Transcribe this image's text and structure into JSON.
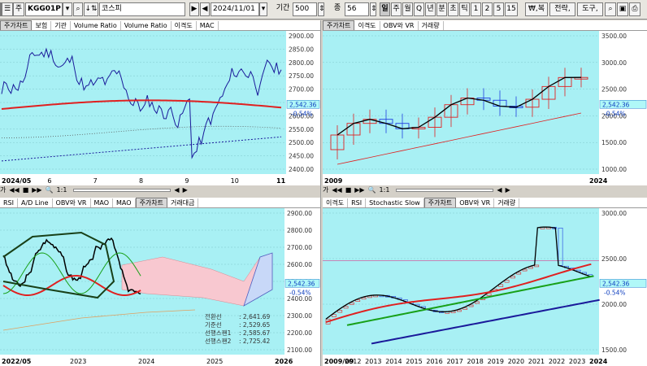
{
  "toolbar": {
    "menu_icon": "☰",
    "mode_label": "주",
    "symbol_code": "KGG01P",
    "symbol_name": "코스피",
    "date": "2024/11/01",
    "period_label": "기간",
    "period_value": "500",
    "count_label": "종",
    "count_value": "56",
    "intervals": [
      "일",
      "주",
      "월",
      "Q",
      "년",
      "분",
      "초",
      "틱",
      "1",
      "2",
      "5",
      "15"
    ],
    "active_interval": "일",
    "btn_won": "₩,복",
    "btn_strategy": "전략,",
    "btn_tools": "도구,"
  },
  "colors": {
    "panel_bg": "#a8f0f4",
    "up_candle": "#e02020",
    "down_candle": "#2040e0",
    "ma_red": "#e02020",
    "ma_green": "#18a018",
    "ma_navy": "#1a1a9a",
    "price_tag": "#b0f8f8"
  },
  "panels": {
    "tl": {
      "tabs": [
        "주가차트",
        "보험",
        "기관",
        "Volume Ratio",
        "Volume Ratio",
        "이격도",
        "MAC"
      ],
      "active_tab": "주가차트",
      "price_tag": "2,542.36",
      "change_pct": "-0.54%",
      "y_ticks": [
        "2900.00",
        "2850.00",
        "2800.00",
        "2750.00",
        "2700.00",
        "2650.00",
        "2600.00",
        "2550.00",
        "2500.00",
        "2450.00",
        "2400.00"
      ],
      "x_labels": [
        "2024/05",
        "6",
        "7",
        "8",
        "9",
        "10",
        "11"
      ]
    },
    "tr": {
      "tabs": [
        "주가차트",
        "이격도",
        "OBV와 VR",
        "거래량"
      ],
      "active_tab": "주가차트",
      "price_tag": "2,542.36",
      "change_pct": "-0.54%",
      "y_ticks": [
        "3500.00",
        "3000.00",
        "2500.00",
        "2000.00",
        "1500.00",
        "1000.00"
      ],
      "x_labels": [
        "2009",
        "2024"
      ]
    },
    "bl": {
      "tabs": [
        "RSI",
        "A/D Line",
        "OBV와 VR",
        "MAO",
        "MAO",
        "주가차트",
        "거래대금"
      ],
      "active_tab": "주가차트",
      "price_tag": "2,542.36",
      "change_pct": "-0.54%",
      "y_ticks": [
        "2900.00",
        "2800.00",
        "2700.00",
        "2600.00",
        "2500.00",
        "2400.00",
        "2300.00",
        "2200.00",
        "2100.00"
      ],
      "x_labels": [
        "2022/05",
        "2023",
        "2024",
        "2025",
        "2026"
      ],
      "ichimoku": [
        {
          "label": "전환선",
          "value": ": 2,641.69"
        },
        {
          "label": "기준선",
          "value": ": 2,529.65"
        },
        {
          "label": "선행스팬1",
          "value": ": 2,585.67"
        },
        {
          "label": "선행스팬2",
          "value": ": 2,725.42"
        }
      ]
    },
    "br": {
      "tabs": [
        "이격도",
        "RSI",
        "Stochastic Slow",
        "주가차트",
        "OBV와 VR",
        "거래량"
      ],
      "active_tab": "주가차트",
      "price_tag": "2,542.36",
      "change_pct": "-0.54%",
      "y_ticks": [
        "3000.00",
        "2500.00",
        "2000.00",
        "1500.00"
      ],
      "x_labels": [
        "2009/09",
        "2012",
        "2013",
        "2014",
        "2015",
        "2016",
        "2017",
        "2018",
        "2019",
        "2020",
        "2021",
        "2022",
        "2023",
        "2024"
      ]
    }
  },
  "controls": {
    "a": "가",
    "first": "◀◀",
    "stop": "■",
    "next": "▶▶",
    "zoom_icon": "🔍",
    "ratio": "1:1",
    "left": "◀",
    "right": "▶"
  }
}
